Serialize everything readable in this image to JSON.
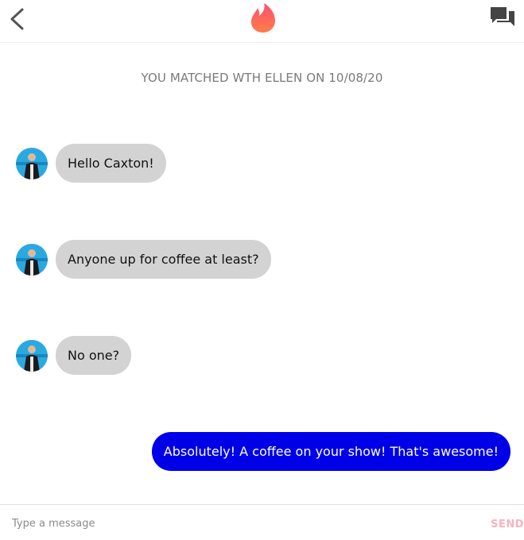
{
  "header": {
    "back_icon": "chevron-left-icon",
    "logo_icon": "flame-icon",
    "messages_icon": "chat-bubbles-icon"
  },
  "match_notice": "YOU MATCHED WTH ELLEN ON 10/08/20",
  "messages": [
    {
      "direction": "incoming",
      "text": "Hello Caxton!"
    },
    {
      "direction": "incoming",
      "text": "Anyone up for coffee at least?"
    },
    {
      "direction": "incoming",
      "text": "No one?"
    },
    {
      "direction": "outgoing",
      "text": "Absolutely! A coffee on your show! That's awesome!"
    }
  ],
  "composer": {
    "placeholder": "Type a message",
    "value": "",
    "send_label": "SEND"
  },
  "colors": {
    "incoming_bubble": "#d3d3d3",
    "outgoing_bubble": "#0000e8",
    "brand_gradient_top": "#ff5a6e",
    "brand_gradient_bottom": "#fd7d4b",
    "send_disabled": "#f5b3bf"
  }
}
